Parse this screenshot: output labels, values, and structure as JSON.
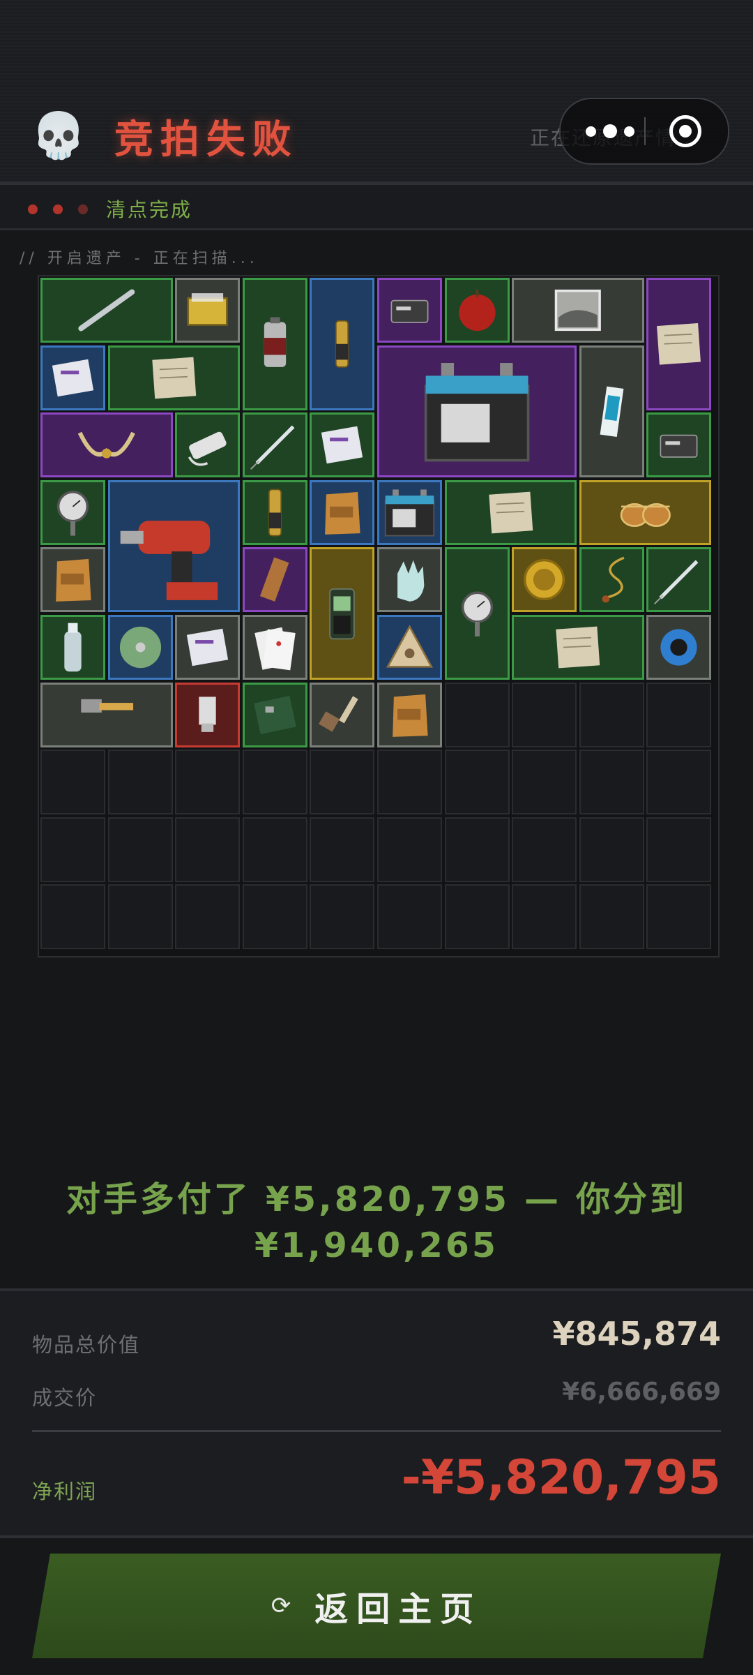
{
  "header": {
    "title": "竞拍失败",
    "status_text": "正在还原遗产情...",
    "skull_glyph": "💀"
  },
  "status": {
    "label": "清点完成",
    "dot_color": "#b3342c"
  },
  "scan": {
    "text": "//  开启遗产 - 正在扫描..."
  },
  "inventory": {
    "items": [
      "crowbar",
      "box-of-nails",
      "spray-paint-can",
      "gold-telescope",
      "router",
      "apple",
      "submarine-photo",
      "ancient-map",
      "medicine-box",
      "documents",
      "car-battery",
      "toothpaste",
      "bull-horns-relic",
      "power-strip",
      "syringe",
      "soap-block",
      "calculator-phone",
      "pressure-gauge",
      "power-drill",
      "hose-pipe",
      "leather-wallet",
      "9v-battery",
      "old-letter",
      "aviator-sunglasses",
      "snack-bag",
      "chocolate-bar",
      "satellite-phone",
      "rubber-glove",
      "manometer",
      "gold-compass",
      "pocket-watch-chain",
      "surgical-clamp",
      "water-bottle",
      "dvd-disc",
      "napkin",
      "playing-cards",
      "triangle-emblem",
      "parchment",
      "blue-tape",
      "claw-hammer",
      "usb-flash-drive",
      "circuit-board",
      "paint-brush",
      "chips-bag"
    ],
    "colors": {
      "green": "#3b9a46",
      "blue": "#3c78bf",
      "purple": "#8b48c2",
      "gold": "#c0a226",
      "gray": "#7a8079",
      "red": "#c63b33"
    }
  },
  "summary": {
    "line1": "对手多付了 ¥5,820,795 — 你分到",
    "line2": "¥1,940,265"
  },
  "stats": {
    "total_label": "物品总价值",
    "total_value": "¥845,874",
    "deal_label": "成交价",
    "deal_value": "¥6,666,669",
    "profit_label": "净利润",
    "profit_value": "-¥5,820,795"
  },
  "home": {
    "label": "返回主页",
    "icon": "refresh-icon"
  }
}
